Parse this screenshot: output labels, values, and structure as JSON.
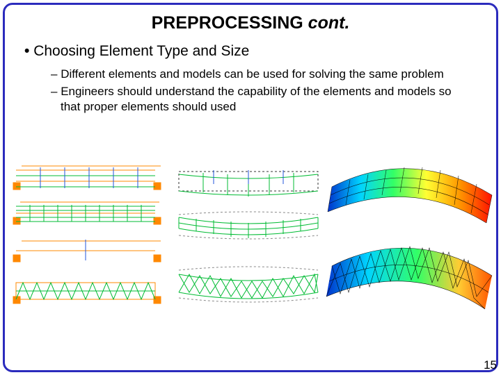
{
  "title_main": "PREPROCESSING ",
  "title_cont": "cont.",
  "bullet1": "Choosing Element Type and Size",
  "sub1": "Different elements and models can be used for solving the same problem",
  "sub2": "Engineers should understand the capability of the elements and models so that proper elements should used",
  "page_number": "15"
}
